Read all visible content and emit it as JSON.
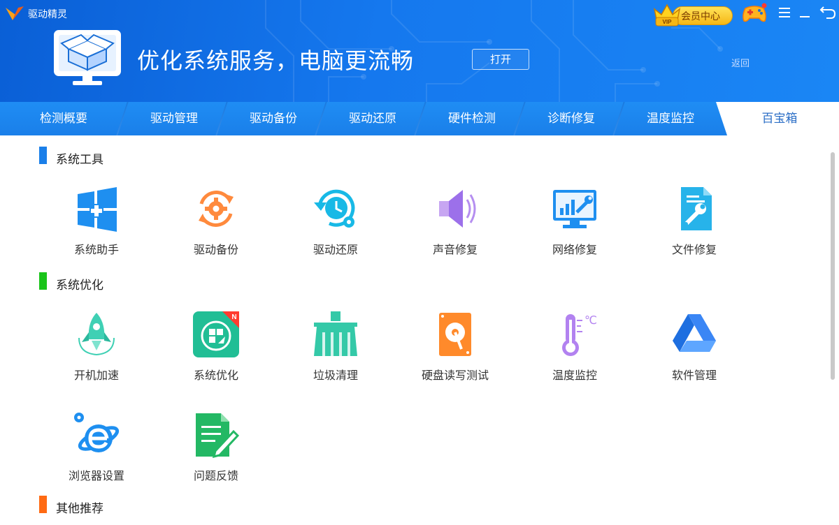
{
  "app": {
    "name": "驱动精灵"
  },
  "header": {
    "banner_title": "优化系统服务，电脑更流畅",
    "open_button": "打开",
    "back_link": "返回",
    "vip_label": "会员中心",
    "vip_badge": "VIP"
  },
  "tabs": [
    {
      "label": "检测概要",
      "active": false
    },
    {
      "label": "驱动管理",
      "active": false
    },
    {
      "label": "驱动备份",
      "active": false
    },
    {
      "label": "驱动还原",
      "active": false
    },
    {
      "label": "硬件检测",
      "active": false
    },
    {
      "label": "诊断修复",
      "active": false
    },
    {
      "label": "温度监控",
      "active": false
    },
    {
      "label": "百宝箱",
      "active": true
    }
  ],
  "sections": [
    {
      "title": "系统工具",
      "bar_color": "#1a7fe9",
      "items": [
        {
          "label": "系统助手",
          "icon": "windows-plus-icon"
        },
        {
          "label": "驱动备份",
          "icon": "gear-cycle-icon"
        },
        {
          "label": "驱动还原",
          "icon": "clock-restore-icon"
        },
        {
          "label": "声音修复",
          "icon": "speaker-icon"
        },
        {
          "label": "网络修复",
          "icon": "monitor-wrench-icon"
        },
        {
          "label": "文件修复",
          "icon": "document-wrench-icon"
        }
      ]
    },
    {
      "title": "系统优化",
      "bar_color": "#19c419",
      "items": [
        {
          "label": "开机加速",
          "icon": "rocket-icon"
        },
        {
          "label": "系统优化",
          "icon": "windows-rocket-icon",
          "badge": "N"
        },
        {
          "label": "垃圾清理",
          "icon": "broom-icon"
        },
        {
          "label": "硬盘读写测试",
          "icon": "hard-disk-icon"
        },
        {
          "label": "温度监控",
          "icon": "thermometer-icon"
        },
        {
          "label": "软件管理",
          "icon": "triangle-drive-icon"
        },
        {
          "label": "浏览器设置",
          "icon": "ie-browser-icon"
        },
        {
          "label": "问题反馈",
          "icon": "feedback-note-icon"
        }
      ]
    },
    {
      "title": "其他推荐",
      "bar_color": "#ff6a13",
      "items": []
    }
  ],
  "colors": {
    "header_blue": "#1578ee",
    "tab_blue": "#1a7fe9",
    "active_tab_text": "#2b6ec6"
  }
}
